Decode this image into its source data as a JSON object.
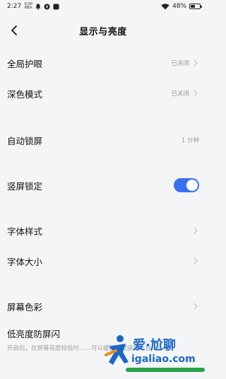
{
  "status_bar": {
    "time": "2:27",
    "speed": "0.00 KB/s",
    "battery": "48%",
    "battery_level": 0.48
  },
  "header": {
    "title": "显示与亮度"
  },
  "settings": {
    "eye_protection": {
      "label": "全局护眼",
      "value": "已关闭"
    },
    "dark_mode": {
      "label": "深色模式",
      "value": "已关闭"
    },
    "auto_lock": {
      "label": "自动锁屏",
      "value": "1 分钟"
    },
    "portrait_lock": {
      "label": "竖屏锁定",
      "enabled": true
    },
    "font_style": {
      "label": "字体样式"
    },
    "font_size": {
      "label": "字体大小"
    },
    "screen_color": {
      "label": "屏幕色彩"
    },
    "low_brightness_antiflicker": {
      "label": "低亮度防屏闪",
      "description": "开启后，在屏幕亮度较低时……可以缓解视觉疲劳，但……点。"
    }
  },
  "watermark": {
    "line1": "爱·尬聊",
    "line2": "igaliao.com"
  },
  "colors": {
    "accent": "#3a6ff0",
    "background": "#f4f5f7",
    "secondary_text": "#9a9a9a",
    "watermark_blue": "#1c67c8",
    "watermark_green": "#27a148"
  }
}
